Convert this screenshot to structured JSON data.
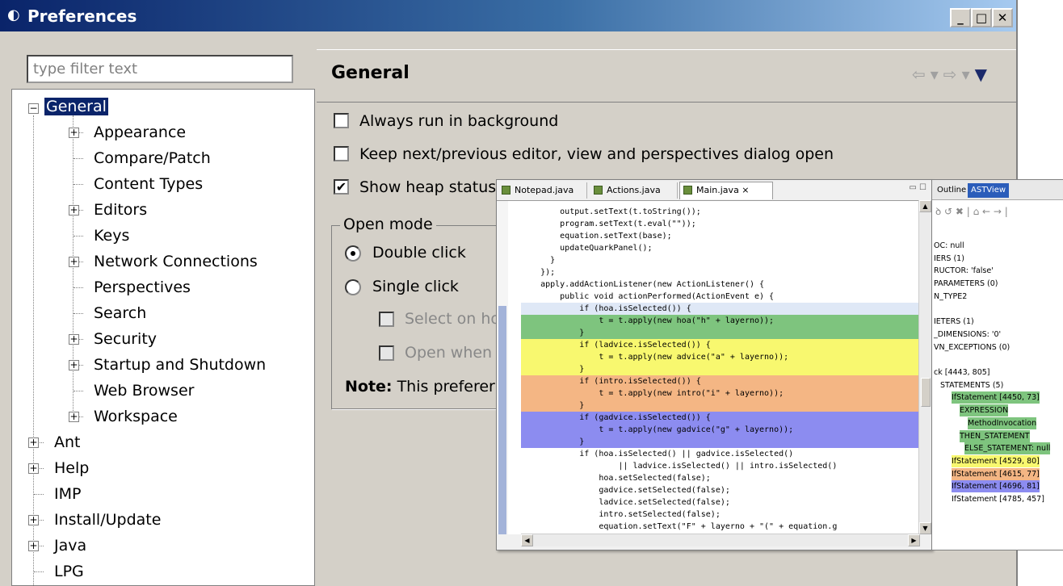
{
  "window": {
    "title": "Preferences",
    "min": "_",
    "max": "□",
    "close": "✕"
  },
  "filter": {
    "placeholder": "type filter text"
  },
  "tree": {
    "general": "General",
    "general_children": [
      "Appearance",
      "Compare/Patch",
      "Content Types",
      "Editors",
      "Keys",
      "Network Connections",
      "Perspectives",
      "Search",
      "Security",
      "Startup and Shutdown",
      "Web Browser",
      "Workspace"
    ],
    "top_items": [
      "Ant",
      "Help",
      "IMP",
      "Install/Update",
      "Java",
      "LPG"
    ]
  },
  "page": {
    "title": "General",
    "nav": {
      "back": "⇦",
      "down1": "▾",
      "forward": "⇨",
      "down2": "▾",
      "menu": "▼"
    },
    "opt_background": "Always run in background",
    "opt_keep_next": "Keep next/previous editor, view and perspectives dialog open",
    "opt_heap": "Show heap status",
    "heap_checked": "✔",
    "group_label": "Open mode",
    "radio_double": "Double click",
    "radio_single": "Single click",
    "select_hover": "Select on ho",
    "open_when": "Open when",
    "note_bold": "Note:",
    "note_text": "This preferer"
  },
  "editor": {
    "tabs": [
      "Notepad.java",
      "Actions.java",
      "Main.java ⨯"
    ],
    "lines": [
      "        output.setText(t.toString());",
      "        program.setText(t.eval(\"\"));",
      "        equation.setText(base);",
      "        updateQuarkPanel();",
      "      }",
      "    });",
      "    apply.addActionListener(new ActionListener() {",
      "        public void actionPerformed(ActionEvent e) {",
      "            if (hoa.isSelected()) {",
      "                t = t.apply(new hoa(\"h\" + layerno));",
      "            }",
      "            if (ladvice.isSelected()) {",
      "                t = t.apply(new advice(\"a\" + layerno));",
      "            }",
      "            if (intro.isSelected()) {",
      "                t = t.apply(new intro(\"i\" + layerno));",
      "            }",
      "            if (gadvice.isSelected()) {",
      "                t = t.apply(new gadvice(\"g\" + layerno));",
      "            }",
      "            if (hoa.isSelected() || gadvice.isSelected()",
      "                    || ladvice.isSelected() || intro.isSelected()",
      "                hoa.setSelected(false);",
      "                gadvice.setSelected(false);",
      "                ladvice.setSelected(false);",
      "                intro.setSelected(false);",
      "                equation.setText(\"F\" + layerno + \"(\" + equation.g",
      "                        + \")\");"
    ]
  },
  "ast": {
    "tabs": [
      "Outline",
      "ASTView"
    ],
    "lines": [
      "OC: null",
      "IERS (1)",
      "RUCTOR: 'false'",
      "PARAMETERS (0)",
      "N_TYPE2",
      "",
      "IETERS (1)",
      "_DIMENSIONS: '0'",
      "VN_EXCEPTIONS (0)",
      "",
      "ck [4443, 805]",
      "STATEMENTS (5)",
      "IfStatement [4450, 73]",
      "EXPRESSION",
      "MethodInvocation",
      "THEN_STATEMENT",
      "ELSE_STATEMENT: null",
      "IfStatement [4529, 80]",
      "IfStatement [4615, 77]",
      "IfStatement [4696, 81]",
      "IfStatement [4785, 457]"
    ]
  },
  "colors": {
    "green": "#7ec47e",
    "yellow": "#f8f86f",
    "orange": "#f4b684",
    "blue": "#8c8cf0",
    "title_bar": "#0a246a"
  }
}
